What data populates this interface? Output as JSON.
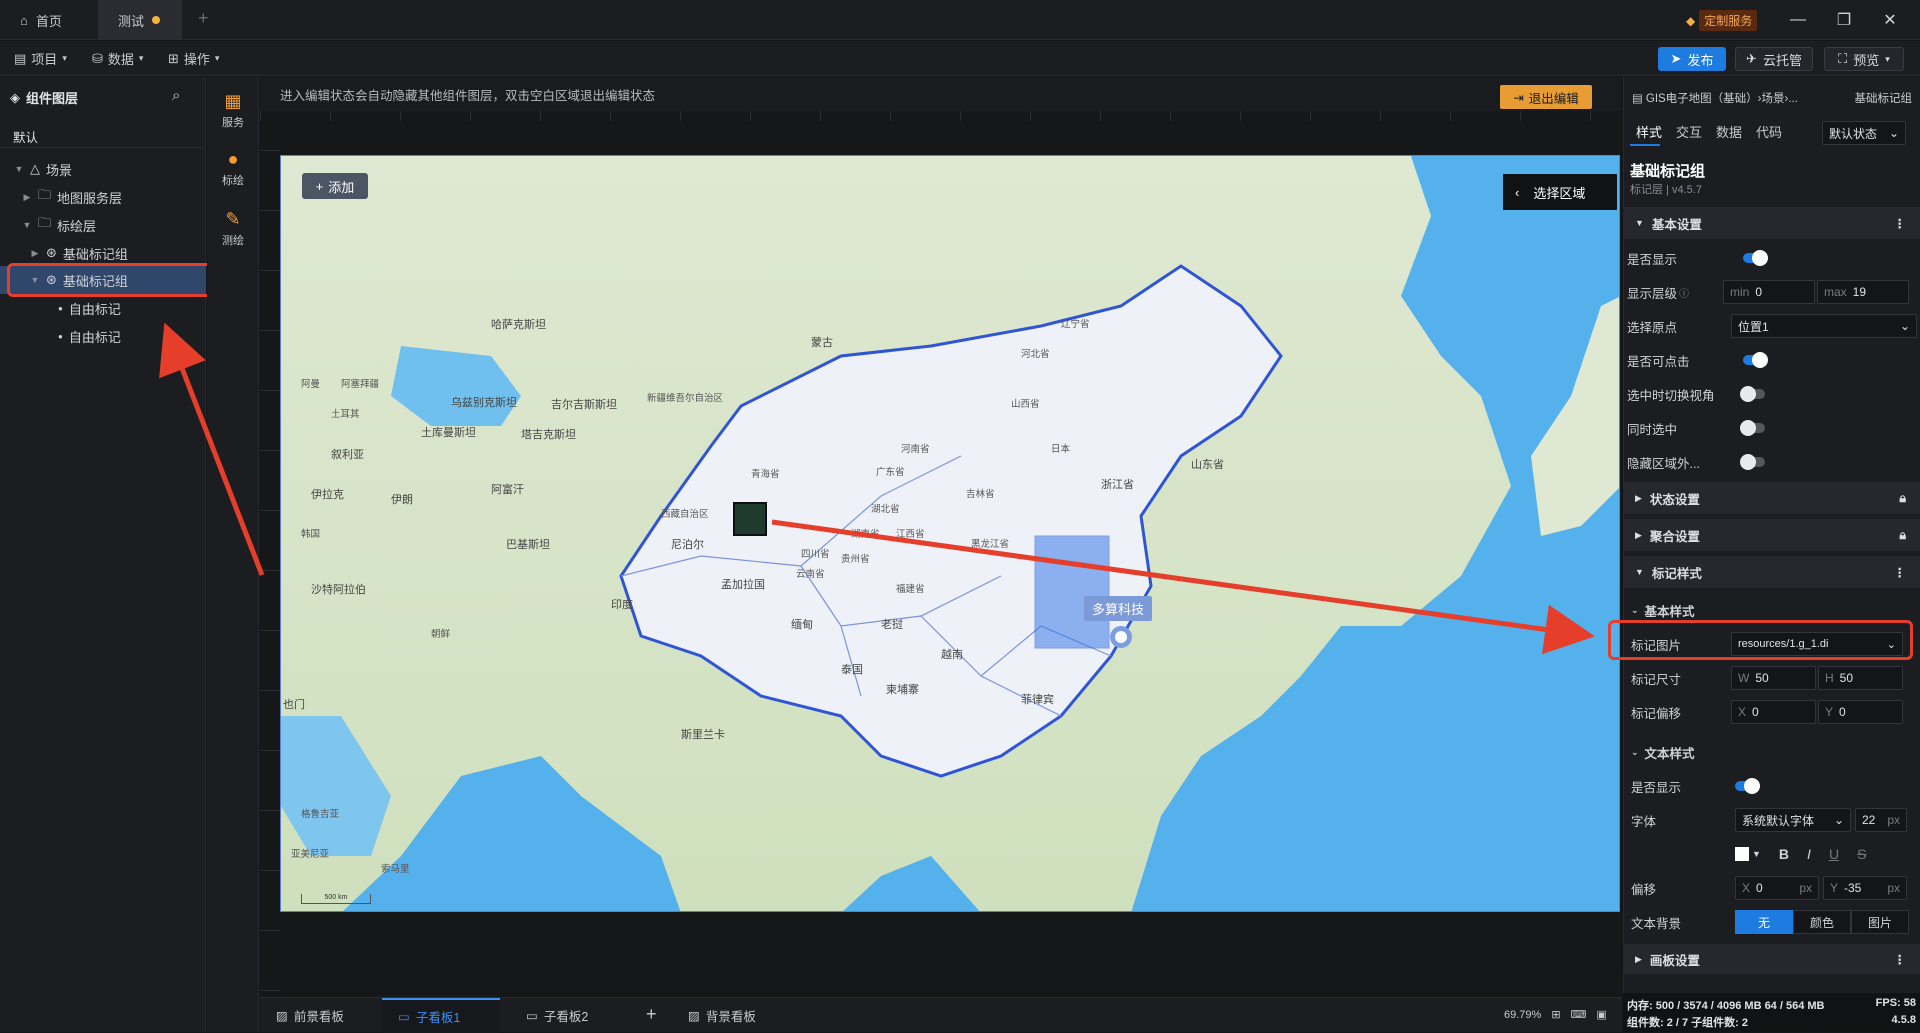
{
  "titlebar": {
    "tabs": [
      {
        "label": "首页"
      },
      {
        "label": "测试"
      }
    ],
    "custom_service": "定制服务"
  },
  "toolbar": {
    "menus": [
      "项目",
      "数据",
      "操作"
    ],
    "publish": "发布",
    "cloud": "云托管",
    "preview": "预览"
  },
  "layers": {
    "title": "组件图层",
    "tab": "默认",
    "tree": [
      {
        "label": "场景",
        "level": 0
      },
      {
        "label": "地图服务层",
        "level": 1
      },
      {
        "label": "标绘层",
        "level": 1
      },
      {
        "label": "基础标记组",
        "level": 2
      },
      {
        "label": "基础标记组",
        "level": 2
      },
      {
        "label": "自由标记",
        "level": 3
      },
      {
        "label": "自由标记",
        "level": 3
      }
    ]
  },
  "tools": [
    "服务",
    "标绘",
    "测绘"
  ],
  "canvas": {
    "hint": "进入编辑状态会自动隐藏其他组件图层，双击空白区域退出编辑状态",
    "exit": "退出编辑",
    "add": "添加",
    "select_area": "选择区域",
    "marker_text": "多算科技",
    "scale": "500 km"
  },
  "map_labels": [
    "哈萨克斯坦",
    "蒙古",
    "新疆维吾尔自治区",
    "乌兹别克斯坦",
    "吉尔吉斯斯坦",
    "塔吉克斯坦",
    "土库曼斯坦",
    "阿富汗",
    "伊朗",
    "伊拉克",
    "叙利亚",
    "沙特阿拉伯",
    "也门",
    "巴基斯坦",
    "印度",
    "尼泊尔",
    "孟加拉国",
    "缅甸",
    "泰国",
    "老挝",
    "越南",
    "柬埔寨",
    "菲律宾",
    "斯里兰卡",
    "西藏自治区",
    "青海省",
    "四川省",
    "云南省",
    "贵州省",
    "湖南省",
    "湖北省",
    "江西省",
    "福建省",
    "广东省",
    "河南省",
    "山西省",
    "河北省",
    "辽宁省",
    "吉林省",
    "黑龙江省",
    "山东省",
    "浙江省",
    "日本",
    "韩国",
    "朝鲜",
    "土耳其",
    "阿曼",
    "阿塞拜疆",
    "格鲁吉亚",
    "亚美尼亚",
    "索马里"
  ],
  "bottom_tabs": [
    {
      "label": "前景看板"
    },
    {
      "label": "子看板1"
    },
    {
      "label": "子看板2"
    },
    {
      "label": "背景看板"
    }
  ],
  "zoom": "69.79%",
  "props": {
    "breadcrumb": "GIS电子地图（基础）›场景›...",
    "breadcrumb_right": "基础标记组",
    "tabs": [
      "样式",
      "交互",
      "数据",
      "代码"
    ],
    "state": "默认状态",
    "comp_title": "基础标记组",
    "comp_sub": "标记层 | v4.5.7",
    "basic_section": "基本设置",
    "rows": {
      "show": "是否显示",
      "level": "显示层级",
      "level_min_label": "min",
      "level_min": "0",
      "level_max_label": "max",
      "level_max": "19",
      "origin": "选择原点",
      "origin_value": "位置1",
      "clickable": "是否可点击",
      "switch_view": "选中时切换视角",
      "same_select": "同时选中",
      "hide_outside": "隐藏区域外..."
    },
    "state_section": "状态设置",
    "cluster_section": "聚合设置",
    "marker_style_section": "标记样式",
    "basic_style": "基本样式",
    "marker_image": "标记图片",
    "marker_image_value": "resources/1.g_1.di",
    "marker_size": "标记尺寸",
    "size_w_label": "W",
    "size_w": "50",
    "size_h_label": "H",
    "size_h": "50",
    "marker_offset": "标记偏移",
    "off_x_label": "X",
    "off_x": "0",
    "off_y_label": "Y",
    "off_y": "0",
    "text_style": "文本样式",
    "text_show": "是否显示",
    "font": "字体",
    "font_value": "系统默认字体",
    "font_size": "22",
    "px": "px",
    "text_offset": "偏移",
    "toff_x": "0",
    "toff_y": "-35",
    "text_bg": "文本背景",
    "bg_options": [
      "无",
      "颜色",
      "图片"
    ],
    "panel_section": "画板设置"
  },
  "status": {
    "memory": "内存: 500 / 3574 / 4096 MB 64 / 564 MB",
    "fps": "FPS: 58",
    "counts": "组件数: 2 / 7 子组件数: 2",
    "version": "4.5.8"
  },
  "colors": {
    "accent": "#1e7ce0",
    "warning": "#e79c34",
    "annotation": "#e53e2b"
  }
}
